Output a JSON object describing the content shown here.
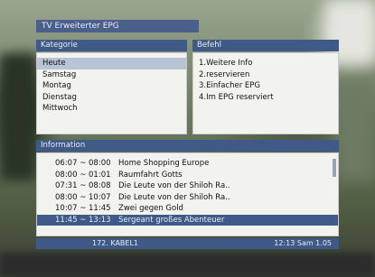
{
  "title": "TV Erweiterter EPG",
  "categories": {
    "header": "Kategorie",
    "items": [
      "Heute",
      "Samstag",
      "Montag",
      "Dienstag",
      "Mittwoch"
    ],
    "selected_index": 0
  },
  "actions": {
    "header": "Befehl",
    "items": [
      "1.Weitere Info",
      "2.reservieren",
      "3.Einfacher EPG",
      "4.Im EPG reserviert"
    ]
  },
  "information": {
    "header": "Information",
    "rows": [
      {
        "time": "06:07 ~ 08:00",
        "title": "Home Shopping Europe"
      },
      {
        "time": "08:00 ~ 01:01",
        "title": "Raumfahrt Gotts"
      },
      {
        "time": "07:31 ~ 08:08",
        "title": "Die Leute von der Shiloh Ra.."
      },
      {
        "time": "08:00 ~ 10:07",
        "title": "Die Leute von der Shiloh Ra.."
      },
      {
        "time": "10:07 ~ 11:45",
        "title": "Zwei gegen Gold"
      },
      {
        "time": "11:45 ~ 13:13",
        "title": "Sergeant großes Abenteuer"
      }
    ],
    "selected_index": 5
  },
  "status": {
    "channel": "172. KABEL1",
    "clock": "12:13 Sam 1.05"
  }
}
